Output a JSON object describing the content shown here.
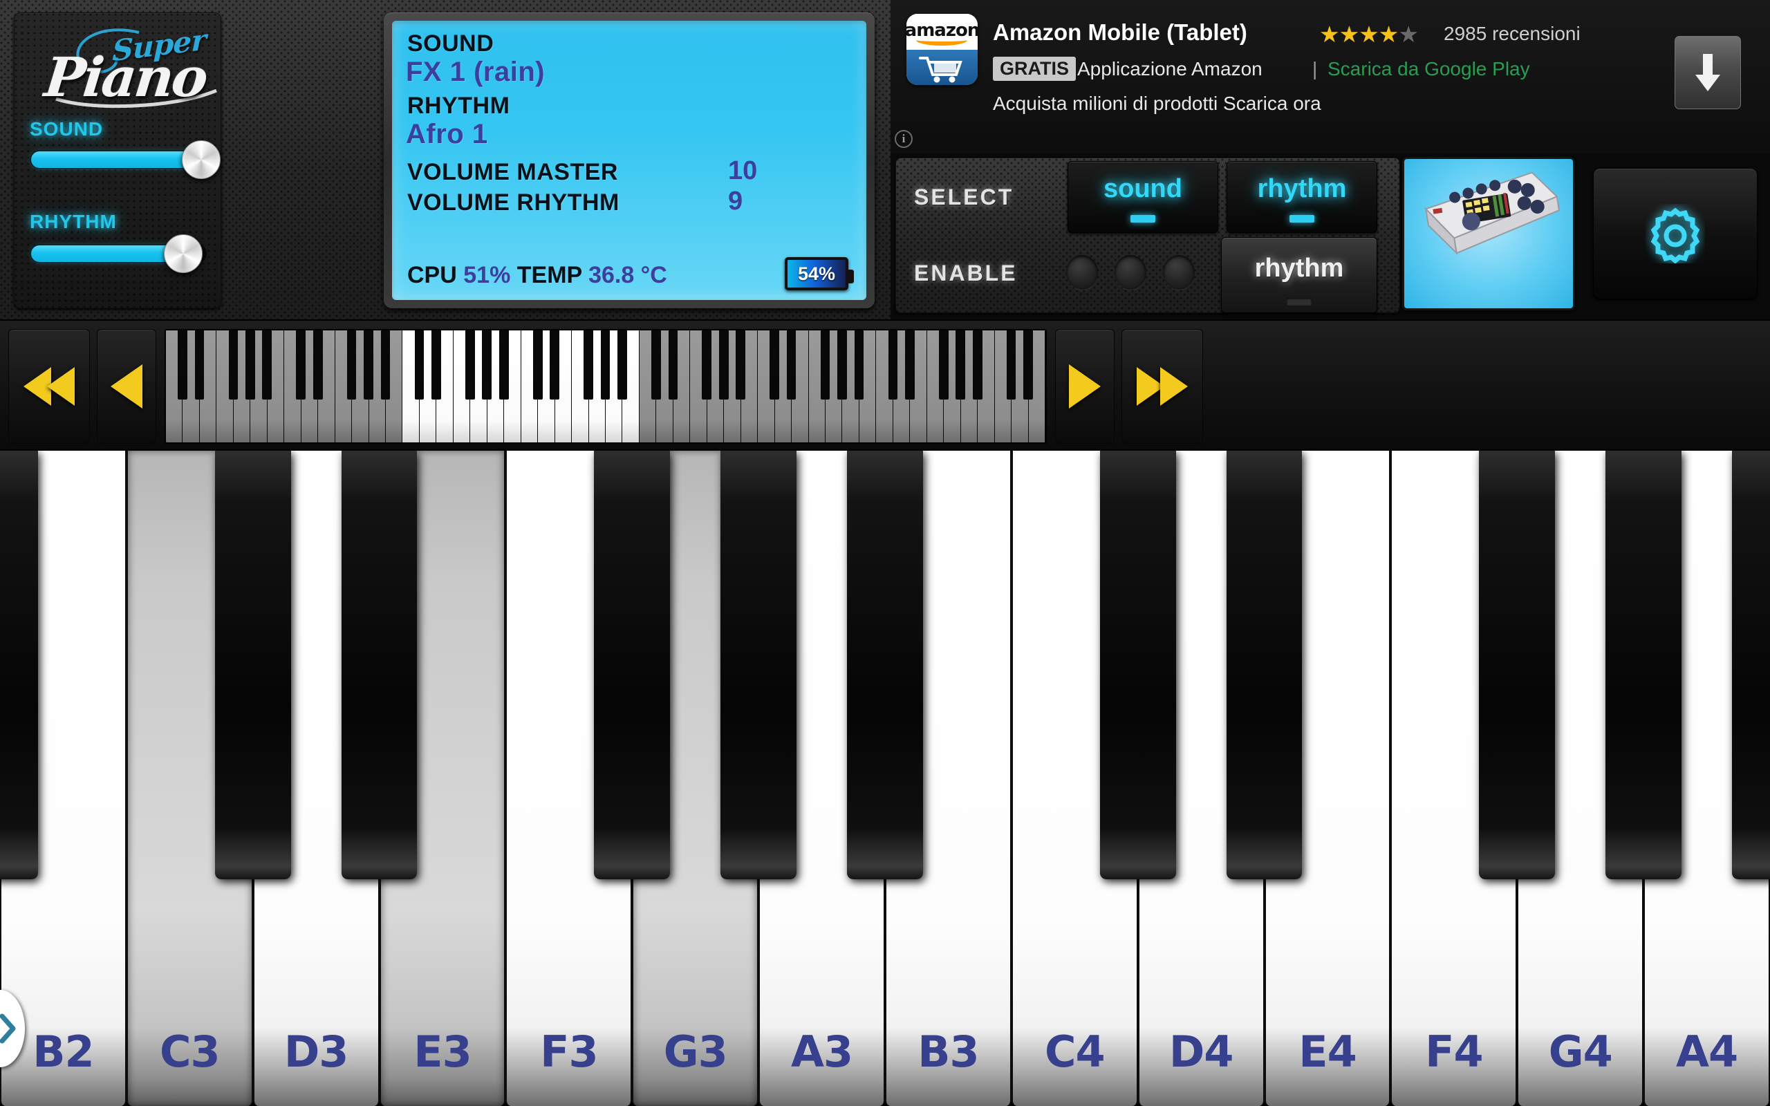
{
  "app": {
    "logo_main": "Piano",
    "logo_accent": "Super"
  },
  "sliders": {
    "sound": {
      "label": "SOUND",
      "value": 100
    },
    "rhythm": {
      "label": "RHYTHM",
      "value": 90
    }
  },
  "lcd": {
    "sound_label": "SOUND",
    "sound_value": "FX 1 (rain)",
    "rhythm_label": "RHYTHM",
    "rhythm_value": "Afro 1",
    "volume_master_label": "VOLUME MASTER",
    "volume_master_value": "10",
    "volume_rhythm_label": "VOLUME RHYTHM",
    "volume_rhythm_value": "9",
    "cpu_label": "CPU",
    "cpu_value": "51%",
    "temp_label": "TEMP",
    "temp_value": "36.8 °C",
    "battery_value": "54%"
  },
  "ad": {
    "title": "Amazon Mobile (Tablet)",
    "stars_filled": 4,
    "stars_total": 5,
    "reviews": "2985 recensioni",
    "free_badge": "GRATIS",
    "app_name": "Applicazione Amazon",
    "separator": "|",
    "store_link": "Scarica da Google Play",
    "description": "Acquista milioni di prodotti Scarica ora",
    "icon_word": "amazon",
    "info_glyph": "i",
    "accent_green": "#2a9d52",
    "accent_orange": "#ff9900"
  },
  "controls": {
    "select_label": "SELECT",
    "select_sound": "sound",
    "select_rhythm": "rhythm",
    "enable_label": "ENABLE",
    "enable_rhythm": "rhythm",
    "led_count": 3,
    "accent_cyan": "#2ecdf2"
  },
  "navigation": {
    "prev_page": "rewind-double-left",
    "prev_step": "rewind-left",
    "next_step": "forward-right",
    "next_page": "forward-double-right",
    "accent_gold": "#f2cb1e"
  },
  "transport": {
    "play": "play",
    "pause": "pause",
    "stop": "stop",
    "record": "record",
    "active": "stop",
    "stop_color": "#23c7f0",
    "record_color": "#cc1818"
  },
  "keyboard": {
    "white_keys": [
      {
        "label": "B2",
        "state": "up"
      },
      {
        "label": "C3",
        "state": "down"
      },
      {
        "label": "D3",
        "state": "up"
      },
      {
        "label": "E3",
        "state": "down"
      },
      {
        "label": "F3",
        "state": "up"
      },
      {
        "label": "G3",
        "state": "down"
      },
      {
        "label": "A3",
        "state": "up"
      },
      {
        "label": "B3",
        "state": "up"
      },
      {
        "label": "C4",
        "state": "up"
      },
      {
        "label": "D4",
        "state": "up"
      },
      {
        "label": "E4",
        "state": "up"
      },
      {
        "label": "F4",
        "state": "up"
      },
      {
        "label": "G4",
        "state": "up"
      },
      {
        "label": "A4",
        "state": "up"
      }
    ],
    "label_color": "#36408c",
    "drawer_handle": "chevron-right",
    "drawer_chevron_color": "#2e7f9e"
  },
  "minikeyboard": {
    "total_keys": 52,
    "viewport_start": 14,
    "viewport_end": 27
  }
}
